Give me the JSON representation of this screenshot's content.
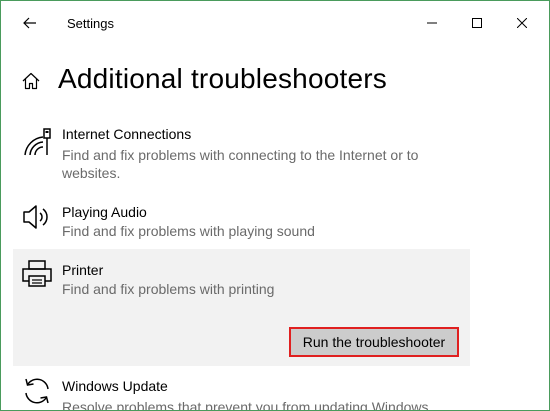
{
  "window": {
    "title": "Settings",
    "controls": [
      "minimize",
      "maximize",
      "close"
    ]
  },
  "header": {
    "title": "Additional troubleshooters",
    "home_icon": "home-icon"
  },
  "items": [
    {
      "icon": "wifi-network-icon",
      "title": "Internet Connections",
      "description": "Find and fix problems with connecting to the Internet or to websites."
    },
    {
      "icon": "speaker-icon",
      "title": "Playing Audio",
      "description": "Find and fix problems with playing sound"
    },
    {
      "icon": "printer-icon",
      "title": "Printer",
      "description": "Find and fix problems with printing",
      "selected": true,
      "button_label": "Run the troubleshooter"
    },
    {
      "icon": "update-sync-icon",
      "title": "Windows Update",
      "description": "Resolve problems that prevent you from updating Windows."
    }
  ],
  "colors": {
    "window_border": "#4a9b5c",
    "selected_bg": "#f2f2f2",
    "button_bg": "#cccccc",
    "highlight_border": "#e02020",
    "secondary_text": "#6a6a6a"
  }
}
